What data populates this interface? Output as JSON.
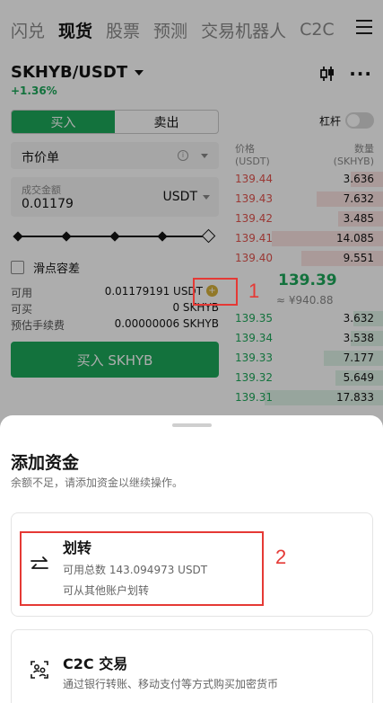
{
  "top_tabs": [
    "闪兑",
    "现货",
    "股票",
    "预测",
    "交易机器人",
    "C2C"
  ],
  "active_tab": "现货",
  "pair": {
    "name": "SKHYB/USDT",
    "change": "+1.36%"
  },
  "side_tabs": {
    "buy": "买入",
    "sell": "卖出"
  },
  "leverage_label": "杠杆",
  "order_type": "市价单",
  "amount": {
    "label": "成交金额",
    "value": "0.01179",
    "currency": "USDT"
  },
  "slippage_label": "滑点容差",
  "info": {
    "available_label": "可用",
    "available_value": "0.01179191 USDT",
    "can_buy_label": "可买",
    "can_buy_value": "0 SKHYB",
    "fee_label": "预估手续费",
    "fee_value": "0.00000006 SKHYB"
  },
  "buy_button": "买入 SKHYB",
  "orderbook": {
    "price_header": "价格",
    "price_unit": "(USDT)",
    "qty_header": "数量",
    "qty_unit": "(SKHYB)",
    "asks": [
      {
        "price": "139.44",
        "qty": "3.636",
        "depth": 0.22
      },
      {
        "price": "139.43",
        "qty": "7.632",
        "depth": 0.45
      },
      {
        "price": "139.42",
        "qty": "3.485",
        "depth": 0.3
      },
      {
        "price": "139.41",
        "qty": "14.085",
        "depth": 0.75
      },
      {
        "price": "139.40",
        "qty": "9.551",
        "depth": 0.55
      }
    ],
    "last_price": "139.39",
    "last_cny": "≈ ¥940.88",
    "bids": [
      {
        "price": "139.35",
        "qty": "3.632",
        "depth": 0.2
      },
      {
        "price": "139.34",
        "qty": "3.538",
        "depth": 0.22
      },
      {
        "price": "139.33",
        "qty": "7.177",
        "depth": 0.4
      },
      {
        "price": "139.32",
        "qty": "5.649",
        "depth": 0.32
      },
      {
        "price": "139.31",
        "qty": "17.833",
        "depth": 0.8
      }
    ]
  },
  "annotations": {
    "marker_1": "1",
    "marker_2": "2"
  },
  "sheet": {
    "title": "添加资金",
    "subtitle": "余额不足，请添加资金以继续操作。",
    "options": [
      {
        "title": "划转",
        "line1": "可用总数 143.094973 USDT",
        "line2": "可从其他账户划转",
        "icon": "transfer-arrows-icon"
      },
      {
        "title": "C2C 交易",
        "line1": "通过银行转账、移动支付等方式购买加密货币",
        "icon": "c2c-users-icon"
      }
    ]
  },
  "colors": {
    "green": "#1ca85a",
    "red": "#e3544e",
    "marker": "#e53935"
  }
}
